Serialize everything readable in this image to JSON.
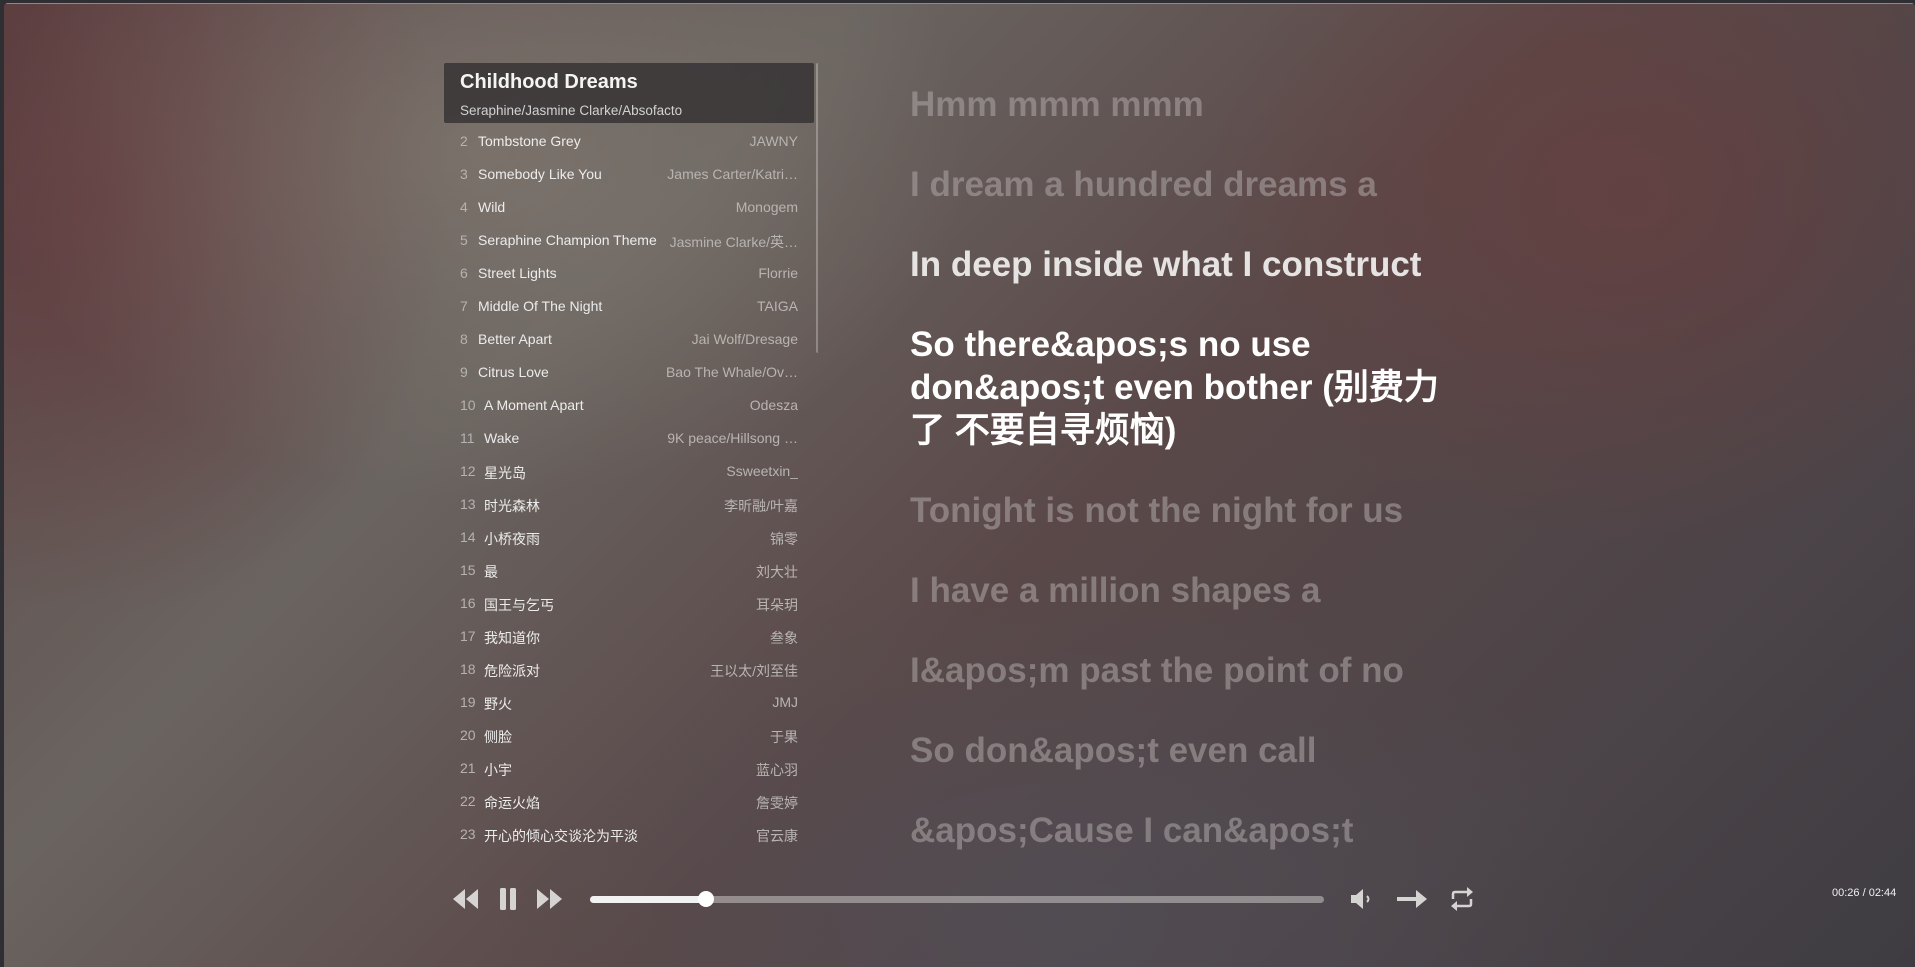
{
  "now_playing": {
    "title": "Childhood Dreams",
    "artist": "Seraphine/Jasmine Clarke/Absofacto"
  },
  "playlist": [
    {
      "num": "2",
      "name": "Tombstone Grey",
      "artist": "JAWNY"
    },
    {
      "num": "3",
      "name": "Somebody Like You",
      "artist": "James Carter/Katri…"
    },
    {
      "num": "4",
      "name": "Wild",
      "artist": "Monogem"
    },
    {
      "num": "5",
      "name": "Seraphine Champion Theme",
      "artist": "Jasmine Clarke/英…"
    },
    {
      "num": "6",
      "name": "Street Lights",
      "artist": "Florrie"
    },
    {
      "num": "7",
      "name": "Middle Of The Night",
      "artist": "TAIGA"
    },
    {
      "num": "8",
      "name": "Better Apart",
      "artist": "Jai Wolf/Dresage"
    },
    {
      "num": "9",
      "name": "Citrus Love",
      "artist": "Bao The Whale/Ov…"
    },
    {
      "num": "10",
      "name": "A Moment Apart",
      "artist": "Odesza"
    },
    {
      "num": "11",
      "name": "Wake",
      "artist": "9K peace/Hillsong …"
    },
    {
      "num": "12",
      "name": "星光岛",
      "artist": "Ssweetxin_"
    },
    {
      "num": "13",
      "name": "时光森林",
      "artist": "李昕融/叶嘉"
    },
    {
      "num": "14",
      "name": "小桥夜雨",
      "artist": "锦零"
    },
    {
      "num": "15",
      "name": "最",
      "artist": "刘大壮"
    },
    {
      "num": "16",
      "name": "国王与乞丐",
      "artist": "耳朵玥"
    },
    {
      "num": "17",
      "name": "我知道你",
      "artist": "叁象"
    },
    {
      "num": "18",
      "name": "危险派对",
      "artist": "王以太/刘至佳"
    },
    {
      "num": "19",
      "name": "野火",
      "artist": "JMJ"
    },
    {
      "num": "20",
      "name": "侧脸",
      "artist": "于果"
    },
    {
      "num": "21",
      "name": "小宇",
      "artist": "蓝心羽"
    },
    {
      "num": "22",
      "name": "命运火焰",
      "artist": "詹雯婷"
    },
    {
      "num": "23",
      "name": "开心的倾心交谈沦为平淡",
      "artist": "官云康"
    }
  ],
  "lyrics": [
    {
      "text": "Hmm mmm mmm",
      "state": "dim"
    },
    {
      "text": "I dream a hundred dreams a",
      "state": "dim"
    },
    {
      "text": "In deep inside what I construct",
      "state": "near"
    },
    {
      "text": "So there&apos;s no use don&apos;t even bother (别费力了 不要自寻烦恼)",
      "state": "active"
    },
    {
      "text": "Tonight is not the night for us",
      "state": "dim"
    },
    {
      "text": "I have a million shapes a",
      "state": "dim"
    },
    {
      "text": "I&apos;m past the point of no",
      "state": "dim"
    },
    {
      "text": "So don&apos;t even call",
      "state": "dim"
    },
    {
      "text": "&apos;Cause I can&apos;t",
      "state": "dim"
    }
  ],
  "player": {
    "time_text": "00:26 / 02:44",
    "progress": 0.158,
    "icons": {
      "prev": "rewind-icon",
      "pause": "pause-icon",
      "next": "fast-forward-icon",
      "volume": "volume-icon",
      "mode": "arrow-right-icon",
      "repeat": "repeat-icon"
    }
  },
  "colors": {
    "accent": "#ffffff",
    "lyric_dim": "#a9a3a3",
    "lyric_active": "#ffffff"
  }
}
